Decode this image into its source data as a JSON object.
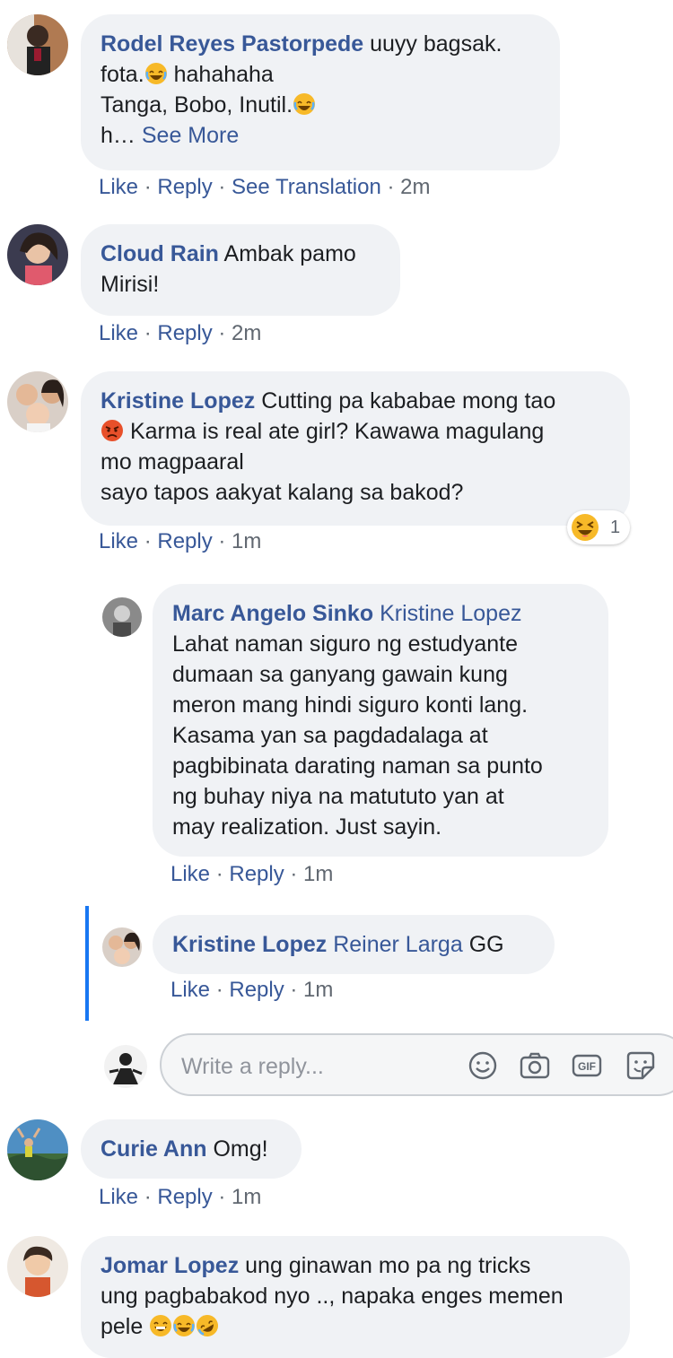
{
  "action_labels": {
    "like": "Like",
    "reply": "Reply",
    "see_translation": "See Translation",
    "sep": " · "
  },
  "comments": [
    {
      "name": "Rodel Reyes Pastorpede",
      "lines": [
        "uuyy bagsak.",
        "fota.",
        " hahahaha",
        "Tanga, Bobo, Inutil.",
        "h…"
      ],
      "see_more": "See More",
      "time": "2m"
    },
    {
      "name": "Cloud Rain",
      "lines": [
        "Ambak pamo",
        "Mirisi!"
      ],
      "time": "2m"
    },
    {
      "name": "Kristine Lopez",
      "lines": [
        "Cutting pa kababae mong tao",
        " Karma is real ate girl? Kawawa magulang",
        "mo magpaaral",
        "sayo tapos aakyat kalang sa bakod?"
      ],
      "time": "1m",
      "reaction_count": "1"
    },
    {
      "name": "Curie Ann",
      "lines": [
        "Omg!"
      ],
      "time": "1m"
    },
    {
      "name": "Jomar Lopez",
      "lines": [
        "ung ginawan mo pa ng tricks",
        "ung pagbabakod nyo .., napaka enges memen",
        "pele "
      ],
      "time": null
    }
  ],
  "replies": [
    {
      "name": "Marc Angelo Sinko",
      "mention": "Kristine Lopez",
      "lines": [
        "Lahat naman siguro ng estudyante",
        "dumaan sa ganyang gawain kung",
        "meron mang hindi siguro konti lang.",
        "Kasama yan sa pagdadalaga at",
        "pagbibinata darating naman sa punto",
        "ng buhay niya na matututo yan at",
        "may realization. Just sayin."
      ],
      "time": "1m"
    },
    {
      "name": "Kristine Lopez",
      "mention": "Reiner Larga",
      "lines": [
        "GG"
      ],
      "time": "1m"
    }
  ],
  "reply_box": {
    "placeholder": "Write a reply..."
  },
  "colors": {
    "link": "#385898",
    "bubble": "#f0f2f5",
    "thread_line": "#1877f2",
    "meta": "#606770"
  },
  "icons": [
    "smiley-icon",
    "camera-icon",
    "gif-icon",
    "sticker-icon",
    "laughing-emoji",
    "angry-emoji",
    "grinning-emoji",
    "rofl-emoji",
    "squinting-emoji"
  ]
}
